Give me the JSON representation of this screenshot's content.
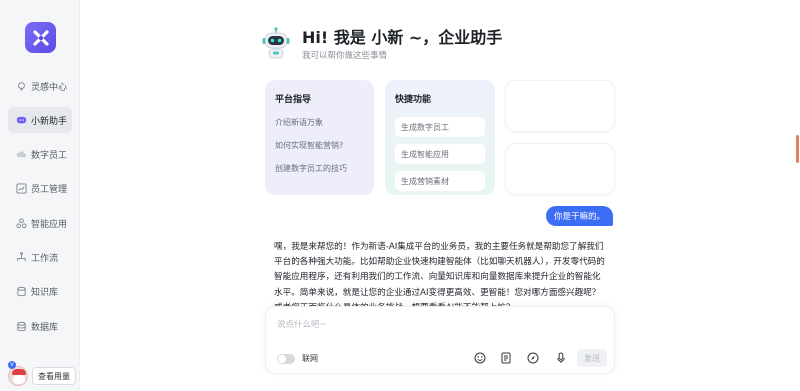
{
  "sidebar": {
    "items": [
      {
        "label": "灵感中心",
        "icon": "bulb-icon"
      },
      {
        "label": "小新助手",
        "icon": "chat-icon",
        "active": true
      },
      {
        "label": "数字员工",
        "icon": "cloud-icon"
      },
      {
        "label": "员工管理",
        "icon": "chart-icon"
      },
      {
        "label": "智能应用",
        "icon": "apps-icon"
      },
      {
        "label": "工作流",
        "icon": "flow-icon"
      },
      {
        "label": "知识库",
        "icon": "database-icon"
      },
      {
        "label": "数据库",
        "icon": "db-icon"
      }
    ],
    "usage_button": "查看用量",
    "badge": "V"
  },
  "header": {
    "title": "Hi! 我是 小新 ~，企业助手",
    "subtitle": "我可以帮你做这些事情"
  },
  "guide": {
    "title": "平台指导",
    "links": [
      "介绍新语万象",
      "如何实现智能营销?",
      "创建数字员工的技巧"
    ]
  },
  "quick": {
    "title": "快捷功能",
    "buttons": [
      "生成数字员工",
      "生成智能应用",
      "生成营销素材"
    ]
  },
  "chat": {
    "user_message": "你是干嘛的。",
    "reply": "嘿，我是来帮您的！作为新语-AI集成平台的业务员，我的主要任务就是帮助您了解我们平台的各种强大功能。比如帮助企业快速构建智能体（比如聊天机器人），开发零代码的智能应用程序，还有利用我们的工作流、向量知识库和向量数据库来提升企业的智能化水平。简单来说，就是让您的企业通过AI变得更高效、更智能！您对哪方面感兴趣呢？或者您正面临什么具体的业务挑战，想要看看AI能不能帮上忙？"
  },
  "composer": {
    "placeholder": "说点什么吧~",
    "network_label": "联网",
    "send_label": "发送"
  },
  "colors": {
    "accent": "#3b6ef5",
    "brand": "#6a5cf0"
  }
}
